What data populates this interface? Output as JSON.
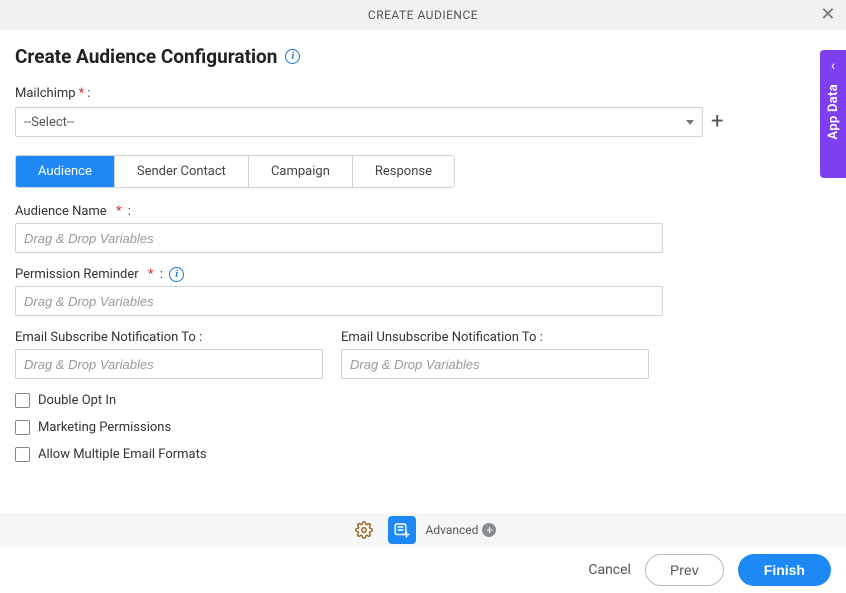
{
  "titlebar": {
    "title": "CREATE AUDIENCE"
  },
  "heading": "Create Audience Configuration",
  "mailchimp": {
    "label": "Mailchimp",
    "selected": "--Select--"
  },
  "tabs": [
    {
      "label": "Audience",
      "active": true
    },
    {
      "label": "Sender Contact",
      "active": false
    },
    {
      "label": "Campaign",
      "active": false
    },
    {
      "label": "Response",
      "active": false
    }
  ],
  "fields": {
    "audience_name": {
      "label": "Audience Name",
      "placeholder": "Drag & Drop Variables"
    },
    "permission_reminder": {
      "label": "Permission Reminder",
      "placeholder": "Drag & Drop Variables"
    },
    "email_subscribe": {
      "label": "Email Subscribe Notification To :",
      "placeholder": "Drag & Drop Variables"
    },
    "email_unsubscribe": {
      "label": "Email Unsubscribe Notification To :",
      "placeholder": "Drag & Drop Variables"
    }
  },
  "checkboxes": {
    "double_opt_in": "Double Opt In",
    "marketing_permissions": "Marketing Permissions",
    "allow_multiple_email_formats": "Allow Multiple Email Formats"
  },
  "bottom": {
    "advanced": "Advanced"
  },
  "footer": {
    "cancel": "Cancel",
    "prev": "Prev",
    "finish": "Finish"
  },
  "side_tab": "App Data"
}
